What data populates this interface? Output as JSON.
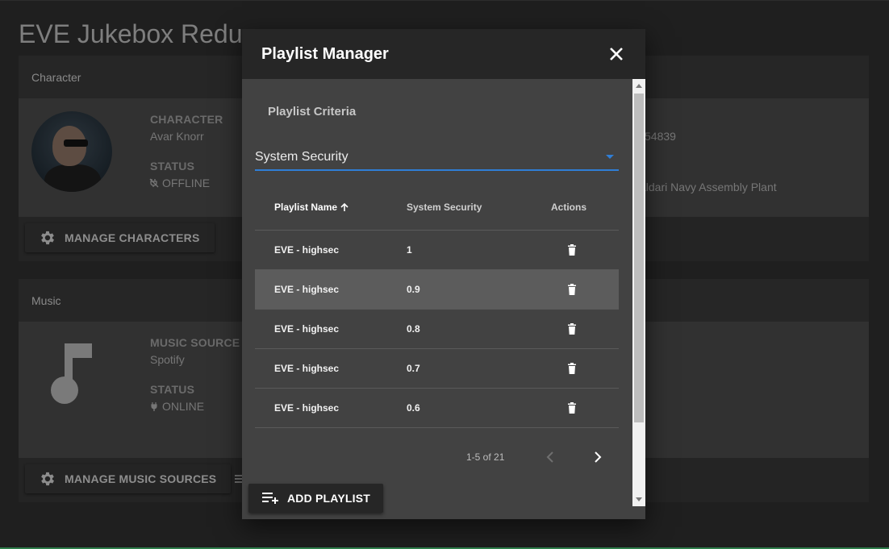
{
  "app": {
    "title": "EVE Jukebox Redu"
  },
  "character_card": {
    "header": "Character",
    "character_label": "CHARACTER",
    "character_name": "Avar Knorr",
    "status_label": "STATUS",
    "status_value": "OFFLINE",
    "visible_id_fragment": "54839",
    "visible_location_fragment": "aldari Navy Assembly Plant",
    "manage_button": "MANAGE CHARACTERS"
  },
  "music_card": {
    "header": "Music",
    "source_label": "MUSIC SOURCE",
    "source_value": "Spotify",
    "status_label": "STATUS",
    "status_value": "ONLINE",
    "manage_button": "MANAGE MUSIC SOURCES"
  },
  "dialog": {
    "title": "Playlist Manager",
    "criteria_label": "Playlist Criteria",
    "criteria_selected": "System Security",
    "columns": {
      "name": "Playlist Name",
      "security": "System Security",
      "actions": "Actions"
    },
    "rows": [
      {
        "name": "EVE - highsec",
        "security": "1"
      },
      {
        "name": "EVE - highsec",
        "security": "0.9"
      },
      {
        "name": "EVE - highsec",
        "security": "0.8"
      },
      {
        "name": "EVE - highsec",
        "security": "0.7"
      },
      {
        "name": "EVE - highsec",
        "security": "0.6"
      }
    ],
    "pagination": {
      "range": "1-5 of 21"
    },
    "add_button": "ADD PLAYLIST"
  },
  "colors": {
    "accent": "#2f7ed6",
    "dialog_bg": "#424242",
    "titlebar_bg": "#262626"
  }
}
